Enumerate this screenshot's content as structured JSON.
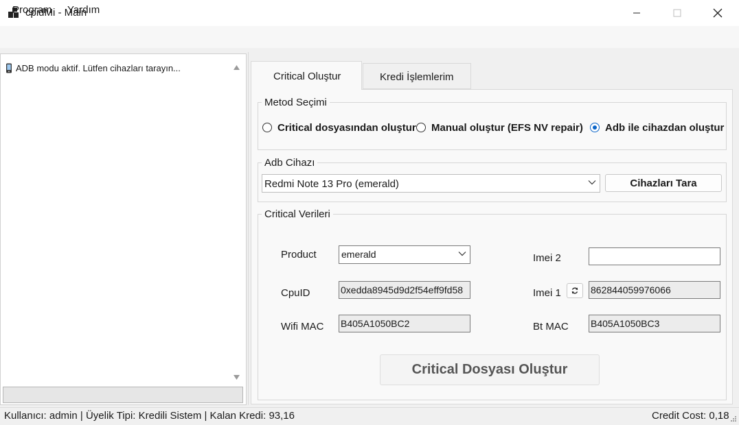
{
  "window": {
    "title": "cpidMi - Main",
    "icons": {
      "app": "app-icon",
      "minimize": "minimize-icon",
      "maximize": "maximize-icon",
      "close": "close-icon"
    }
  },
  "menu": {
    "items": [
      "Program",
      "Yardım"
    ]
  },
  "left_panel": {
    "log_text": "ADB modu aktif. Lütfen cihazları tarayın...",
    "log_icon": "phone-icon"
  },
  "tabs": {
    "active": "Critical Oluştur",
    "items": [
      "Critical Oluştur",
      "Kredi İşlemlerim"
    ]
  },
  "method_group": {
    "title": "Metod Seçimi",
    "options": [
      "Critical dosyasından oluştur",
      "Manual oluştur (EFS  NV repair)",
      "Adb ile cihazdan oluştur"
    ],
    "selected": "Adb ile cihazdan oluştur"
  },
  "adb_group": {
    "title": "Adb Cihazı",
    "selected_device": "Redmi Note 13 Pro (emerald)",
    "scan_button": "Cihazları Tara"
  },
  "critical_group": {
    "title": "Critical Verileri",
    "product_label": "Product",
    "product_value": "emerald",
    "cpuid_label": "CpuID",
    "cpuid_value": "0xedda8945d9d2f54eff9fd58",
    "wifi_label": "Wifi MAC",
    "wifi_value": "B405A1050BC2",
    "imei2_label": "Imei 2",
    "imei2_value": "",
    "imei1_label": "Imei 1",
    "imei1_value": "862844059976066",
    "btmac_label": "Bt MAC",
    "btmac_value": "B405A1050BC3",
    "create_button": "Critical Dosyası Oluştur"
  },
  "status_bar": {
    "left": "Kullanıcı: admin | Üyelik Tipi: Kredili Sistem | Kalan Kredi: 93,16",
    "right": "Credit Cost: 0,18"
  },
  "colors": {
    "accent": "#0a64c8",
    "window_bg": "#f0f0f0",
    "panel_bg": "#f9f9f9"
  }
}
